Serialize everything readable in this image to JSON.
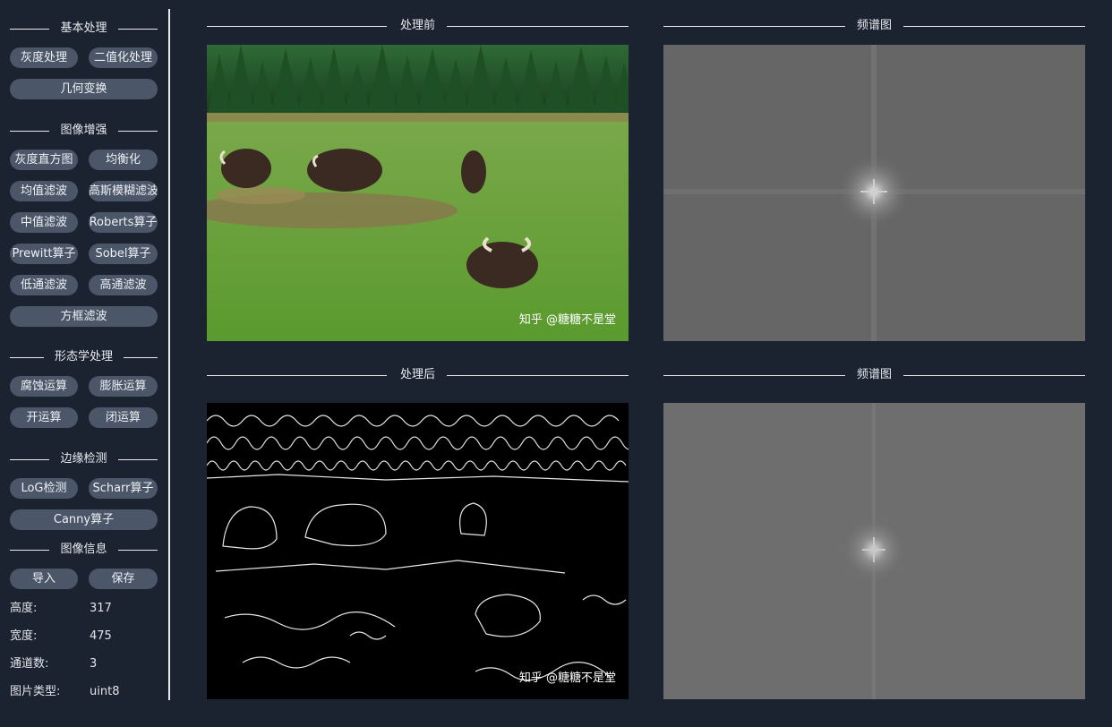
{
  "sidebar": {
    "basic": {
      "title": "基本处理",
      "gray": "灰度处理",
      "binary": "二值化处理",
      "geometry": "几何变换"
    },
    "enhance": {
      "title": "图像增强",
      "hist": "灰度直方图",
      "equalize": "均衡化",
      "mean": "均值滤波",
      "gauss": "高斯模糊滤波",
      "median": "中值滤波",
      "roberts": "Roberts算子",
      "prewitt": "Prewitt算子",
      "sobel": "Sobel算子",
      "lowpass": "低通滤波",
      "highpass": "高通滤波",
      "box": "方框滤波"
    },
    "morph": {
      "title": "形态学处理",
      "erode": "腐蚀运算",
      "dilate": "膨胀运算",
      "open": "开运算",
      "close": "闭运算"
    },
    "edge": {
      "title": "边缘检测",
      "log": "LoG检测",
      "scharr": "Scharr算子",
      "canny": "Canny算子"
    },
    "info": {
      "title": "图像信息",
      "import": "导入",
      "save": "保存",
      "height_label": "高度:",
      "height_value": "317",
      "width_label": "宽度:",
      "width_value": "475",
      "channels_label": "通道数:",
      "channels_value": "3",
      "type_label": "图片类型:",
      "type_value": "uint8"
    }
  },
  "panels": {
    "before_title": "处理前",
    "before_spectrum_title": "频谱图",
    "after_title": "处理后",
    "after_spectrum_title": "频谱图",
    "watermark": "知乎 @糖糖不是堂",
    "watermark_after": "知乎 @糖糖不是堂"
  }
}
